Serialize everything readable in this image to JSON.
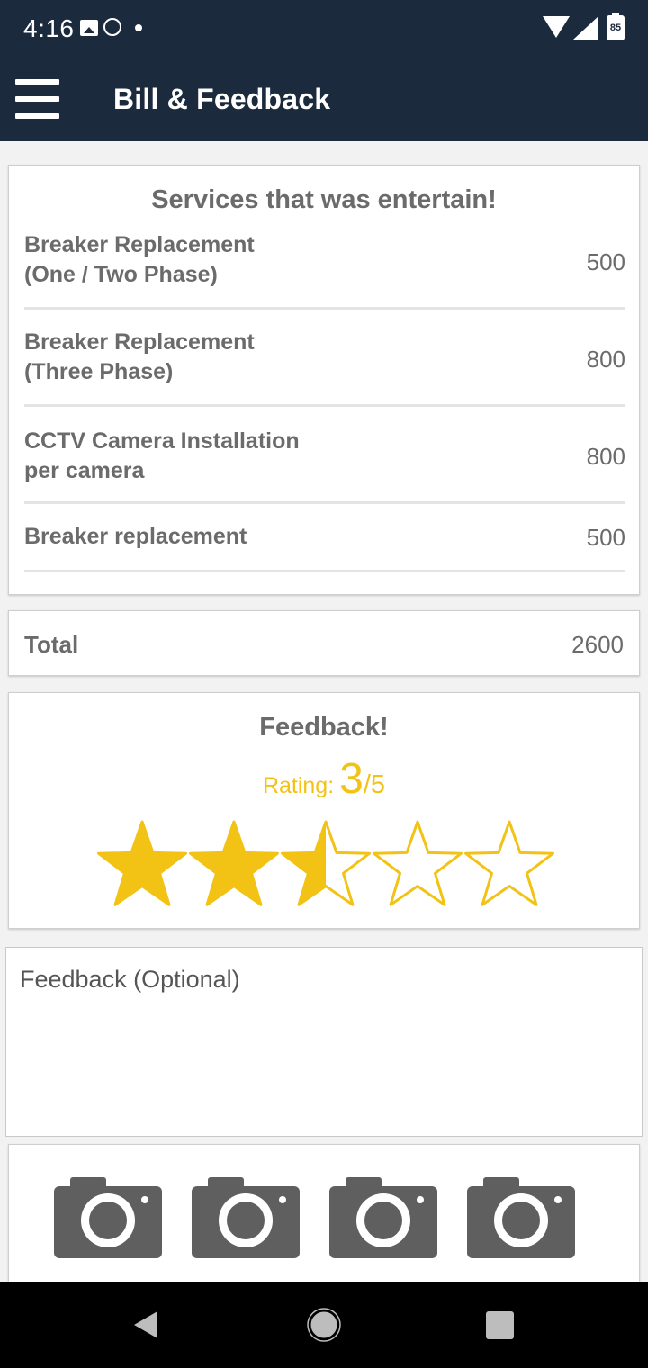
{
  "status_bar": {
    "time": "4:16",
    "battery": "85",
    "icons": [
      "image-icon",
      "whatsapp-icon",
      "dot-icon",
      "wifi-icon",
      "signal-icon",
      "battery-icon"
    ]
  },
  "app_bar": {
    "title": "Bill & Feedback",
    "menu_icon": "hamburger-menu-icon",
    "background_color": "#1c2a3d"
  },
  "services": {
    "title": "Services that was entertain!",
    "items": [
      {
        "name_line1": "Breaker Replacement",
        "name_line2": "(One / Two Phase)",
        "price": "500"
      },
      {
        "name_line1": "Breaker Replacement",
        "name_line2": "(Three Phase)",
        "price": "800"
      },
      {
        "name_line1": "CCTV Camera Installation",
        "name_line2": "per camera",
        "price": "800"
      },
      {
        "name_line1": "Breaker replacement",
        "name_line2": "",
        "price": "500"
      }
    ]
  },
  "total": {
    "label": "Total",
    "value": "2600"
  },
  "feedback": {
    "title": "Feedback!",
    "rating_label": "Rating:",
    "rating_value": "3",
    "rating_max": "/5",
    "stars_filled": 2.5,
    "stars_total": 5,
    "star_color": "#f2c314"
  },
  "feedback_input": {
    "placeholder": "Feedback (Optional)",
    "value": ""
  },
  "photos": {
    "icons": [
      "camera-icon",
      "camera-icon",
      "camera-icon",
      "camera-icon"
    ]
  },
  "nav_bar": {
    "icons": [
      "back-icon",
      "home-icon",
      "recents-icon"
    ]
  }
}
